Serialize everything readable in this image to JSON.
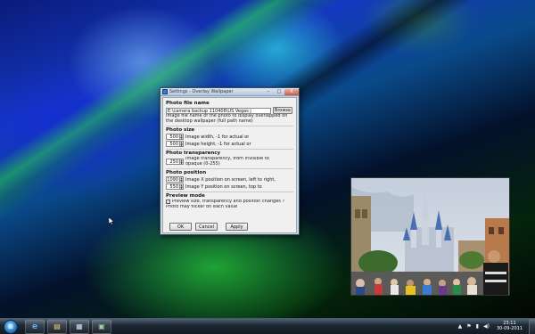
{
  "dialog": {
    "title": "Settings - Overlay Wallpaper",
    "window_buttons": {
      "minimize": "–",
      "maximize": "□",
      "close": "X"
    },
    "photo_file": {
      "section_title": "Photo file name",
      "path_value": "E:\\camera backup 110408\\US Vegas j",
      "browse_label": "Browse",
      "description": "Image file name of the photo to display overlapped on the desktop wallpaper (full path name)"
    },
    "photo_size": {
      "section_title": "Photo size",
      "width_value": "500",
      "width_label": "Image width, -1 for actual or",
      "height_value": "500",
      "height_label": "Image height, -1 for actual or"
    },
    "photo_transparency": {
      "section_title": "Photo transparency",
      "value": "250",
      "description": "Image transparency, from invisible to opaque (0-255)"
    },
    "photo_position": {
      "section_title": "Photo position",
      "x_value": "1090",
      "x_label": "Image X position on screen, left to right,",
      "y_value": "550",
      "y_label": "Image Y position on screen, top to"
    },
    "preview": {
      "section_title": "Preview mode",
      "checkbox_mark": "✓",
      "checkbox_label": "Preview size, transparency and position changes ?",
      "note": "Photo may flicker on each value"
    },
    "buttons": {
      "ok": "OK",
      "cancel": "Cancel",
      "apply": "Apply"
    }
  },
  "taskbar": {
    "start_glyph": "⊞",
    "pinned": [
      {
        "icon": "internet-explorer-icon",
        "glyph": "e"
      },
      {
        "icon": "folder-icon",
        "glyph": "▤"
      },
      {
        "icon": "app-window-icon",
        "glyph": "▦"
      },
      {
        "icon": "monitor-icon",
        "glyph": "▣"
      }
    ],
    "tray": {
      "up_arrow": "▲",
      "flag": "⚑",
      "network": "▮",
      "volume": "◀)",
      "time": "23:11",
      "date": "30-09-2011"
    }
  },
  "colors": {
    "taskbar": "#1e2a36",
    "dialog_frame": "#c9d7e6",
    "accent_blue": "#3a7bd5"
  }
}
